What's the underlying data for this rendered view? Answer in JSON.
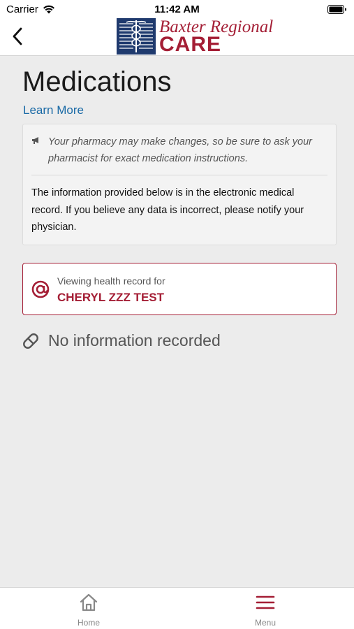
{
  "status_bar": {
    "carrier": "Carrier",
    "time": "11:42 AM"
  },
  "header": {
    "logo_line1": "Baxter Regional",
    "logo_line2": "CARE"
  },
  "page": {
    "title": "Medications",
    "learn_more": "Learn More",
    "note": "Your pharmacy may make changes, so be sure to ask your pharmacist for exact medication instructions.",
    "info": "The information provided below is in the electronic medical record. If you believe any data is incorrect, please notify your physician."
  },
  "record": {
    "label": "Viewing health record for",
    "name": "CHERYL ZZZ TEST"
  },
  "empty_state": {
    "text": "No information recorded"
  },
  "bottom_nav": {
    "home_label": "Home",
    "menu_label": "Menu"
  },
  "colors": {
    "brand": "#a41e35",
    "link": "#1a6aa6",
    "logo_mark": "#1f3a6e",
    "background": "#ececec"
  }
}
